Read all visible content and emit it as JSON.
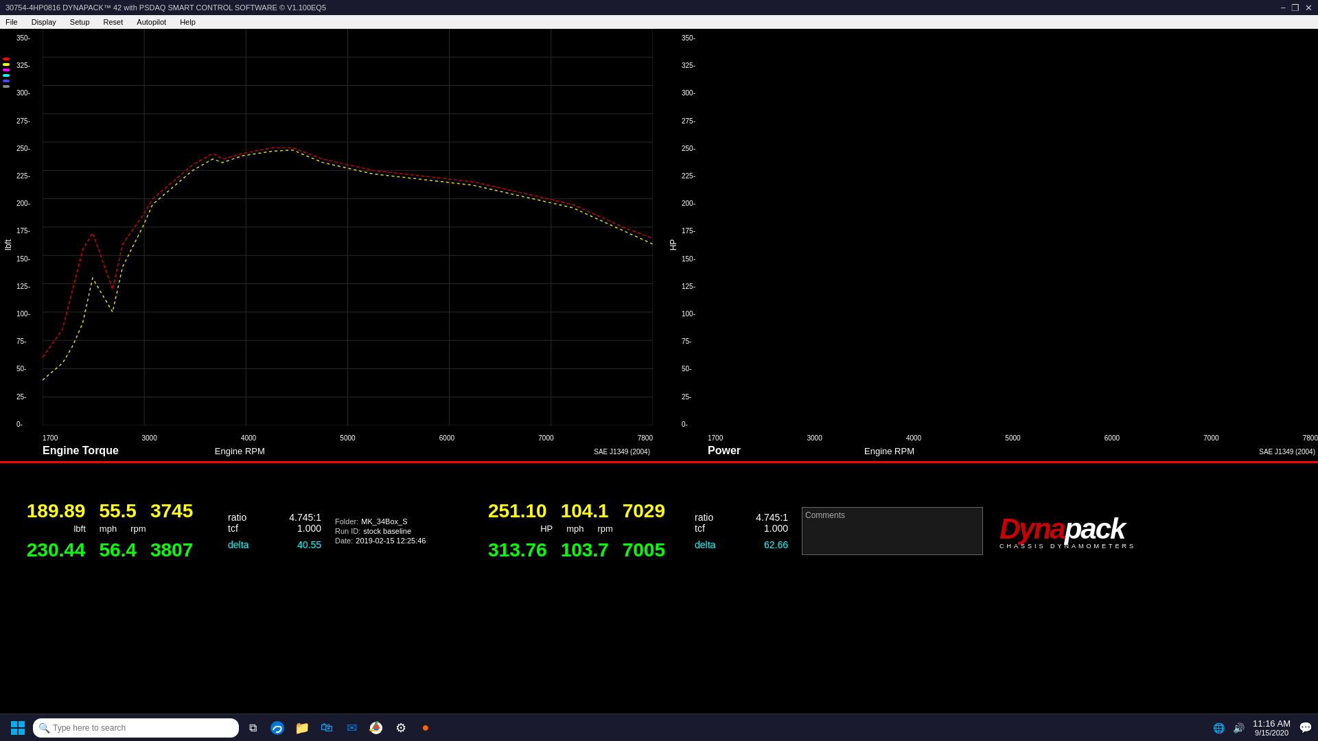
{
  "titlebar": {
    "title": "30754-4HP0816 DYNAPACK™ 42 with PSDAQ SMART CONTROL SOFTWARE © V1.100EQ5",
    "min": "−",
    "restore": "❐",
    "close": "✕"
  },
  "menubar": {
    "items": [
      "File",
      "Display",
      "Setup",
      "Reset",
      "Autopilot",
      "Help"
    ]
  },
  "charts": {
    "left": {
      "title": "Engine Torque",
      "x_label": "Engine RPM",
      "y_label": "lbft",
      "sae": "SAE J1349 (2004)",
      "y_ticks": [
        "350",
        "325",
        "300",
        "275",
        "250",
        "225",
        "200",
        "175",
        "150",
        "125",
        "100",
        "75",
        "50",
        "25",
        "0"
      ],
      "x_ticks": [
        "1700",
        "3000",
        "4000",
        "5000",
        "6000",
        "7000",
        "7800"
      ]
    },
    "right": {
      "title": "Power",
      "x_label": "Engine RPM",
      "y_label": "HP",
      "sae": "SAE J1349 (2004)",
      "y_ticks": [
        "350",
        "325",
        "300",
        "275",
        "250",
        "225",
        "200",
        "175",
        "150",
        "125",
        "100",
        "75",
        "50",
        "25",
        "0"
      ],
      "x_ticks": [
        "1700",
        "3000",
        "4000",
        "5000",
        "6000",
        "7000",
        "7800"
      ]
    }
  },
  "databar": {
    "left": {
      "val1_yellow": "189.89",
      "val2_yellow": "55.5",
      "val3_yellow": "3745",
      "unit1": "lbft",
      "unit2": "mph",
      "unit3": "rpm",
      "val1_green": "230.44",
      "val2_green": "56.4",
      "val3_green": "3807",
      "ratio_label": "ratio",
      "ratio_val": "4.745:1",
      "tcf_label": "tcf",
      "tcf_val": "1.000",
      "delta_label": "delta",
      "delta_val": "40.55"
    },
    "right": {
      "val1_yellow": "251.10",
      "val2_yellow": "104.1",
      "val3_yellow": "7029",
      "unit1": "HP",
      "unit2": "mph",
      "unit3": "rpm",
      "val1_green": "313.76",
      "val2_green": "103.7",
      "val3_green": "7005",
      "ratio_label": "ratio",
      "ratio_val": "4.745:1",
      "tcf_label": "tcf",
      "tcf_val": "1.000",
      "delta_label": "delta",
      "delta_val": "62.66"
    },
    "folder": {
      "folder_label": "Folder:",
      "folder_val": "MK_34Box_S",
      "runid_label": "Run ID:",
      "runid_val": "stock baseline",
      "date_label": "Date:",
      "date_val": "2019-02-15 12:25:46"
    },
    "comments": {
      "label": "Comments"
    }
  },
  "taskbar": {
    "search_placeholder": "Type here to search",
    "time": "11:16 AM",
    "date": "9/15/2020",
    "icons": [
      "task-view",
      "edge-browser",
      "file-explorer",
      "store",
      "mail",
      "edge2",
      "app6",
      "app7"
    ]
  }
}
